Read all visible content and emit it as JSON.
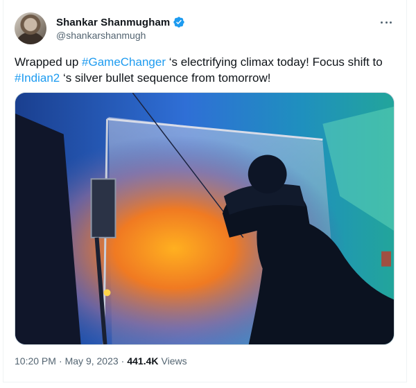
{
  "tweet": {
    "author": {
      "name": "Shankar Shanmugham",
      "handle": "@shankarshanmugh",
      "verified_icon": "verified-badge-icon",
      "verified_color": "#1d9bf0"
    },
    "text_parts": {
      "p1": "Wrapped up ",
      "tag1": "#GameChanger",
      "p2": " ‘s electrifying climax today! Focus shift to ",
      "tag2": "#Indian2",
      "p3": " ‘s silver bullet sequence from tomorrow!"
    },
    "hashtag_color": "#1d9bf0",
    "media": {
      "image_icon": "photo-of-man-in-cap-on-film-set"
    },
    "meta": {
      "time": "10:20 PM",
      "separator": "·",
      "date": "May 9, 2023",
      "views_count": "441.4K",
      "views_label": "Views"
    },
    "more_icon": "more-horizontal-icon"
  }
}
